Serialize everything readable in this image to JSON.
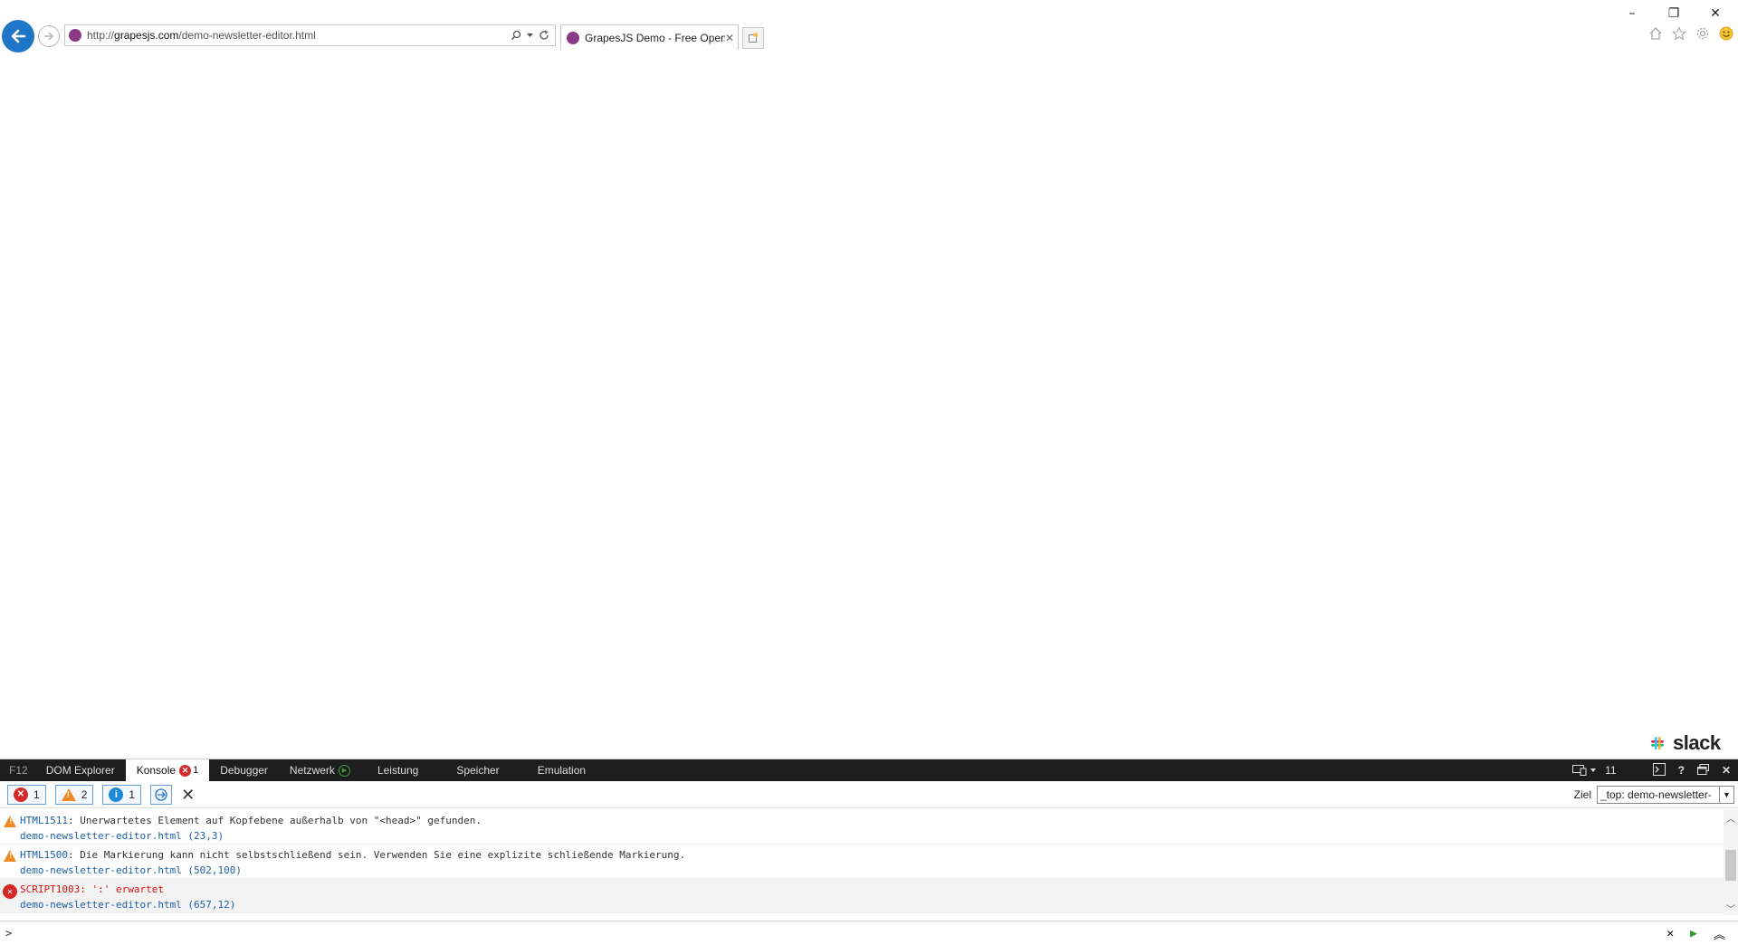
{
  "window": {
    "minimize": "–",
    "maximize": "❐",
    "close": "✕"
  },
  "browser": {
    "url_prefix": "http://",
    "url_domain": "grapesjs.com",
    "url_path": "/demo-newsletter-editor.html",
    "tab_title": "GrapesJS Demo - Free Open...",
    "tab_close": "✕"
  },
  "page": {
    "slack_word": "slack"
  },
  "devtools": {
    "f12": "F12",
    "tabs": [
      {
        "label": "DOM Explorer"
      },
      {
        "label": "Konsole",
        "badge": "1"
      },
      {
        "label": "Debugger"
      },
      {
        "label": "Netzwerk"
      },
      {
        "label": "Leistung"
      },
      {
        "label": "Speicher"
      },
      {
        "label": "Emulation"
      }
    ],
    "emulation_mode": "11",
    "help": "?",
    "filters": {
      "errors": "1",
      "warnings": "2",
      "info": "1"
    },
    "ziel_label": "Ziel",
    "ziel_value": "_top: demo-newsletter-",
    "messages": [
      {
        "level": "warning",
        "code": "HTML1511",
        "text": ": Unerwartetes Element auf Kopfebene außerhalb von \"<head>\" gefunden.",
        "source": "demo-newsletter-editor.html (23,3)"
      },
      {
        "level": "warning",
        "code": "HTML1500",
        "text": ": Die Markierung kann nicht selbstschließend sein. Verwenden Sie eine explizite schließende Markierung.",
        "source": "demo-newsletter-editor.html (502,100)"
      },
      {
        "level": "error",
        "code": "SCRIPT1003",
        "text": ": ':' erwartet",
        "source": "demo-newsletter-editor.html (657,12)"
      }
    ],
    "prompt": ">"
  }
}
